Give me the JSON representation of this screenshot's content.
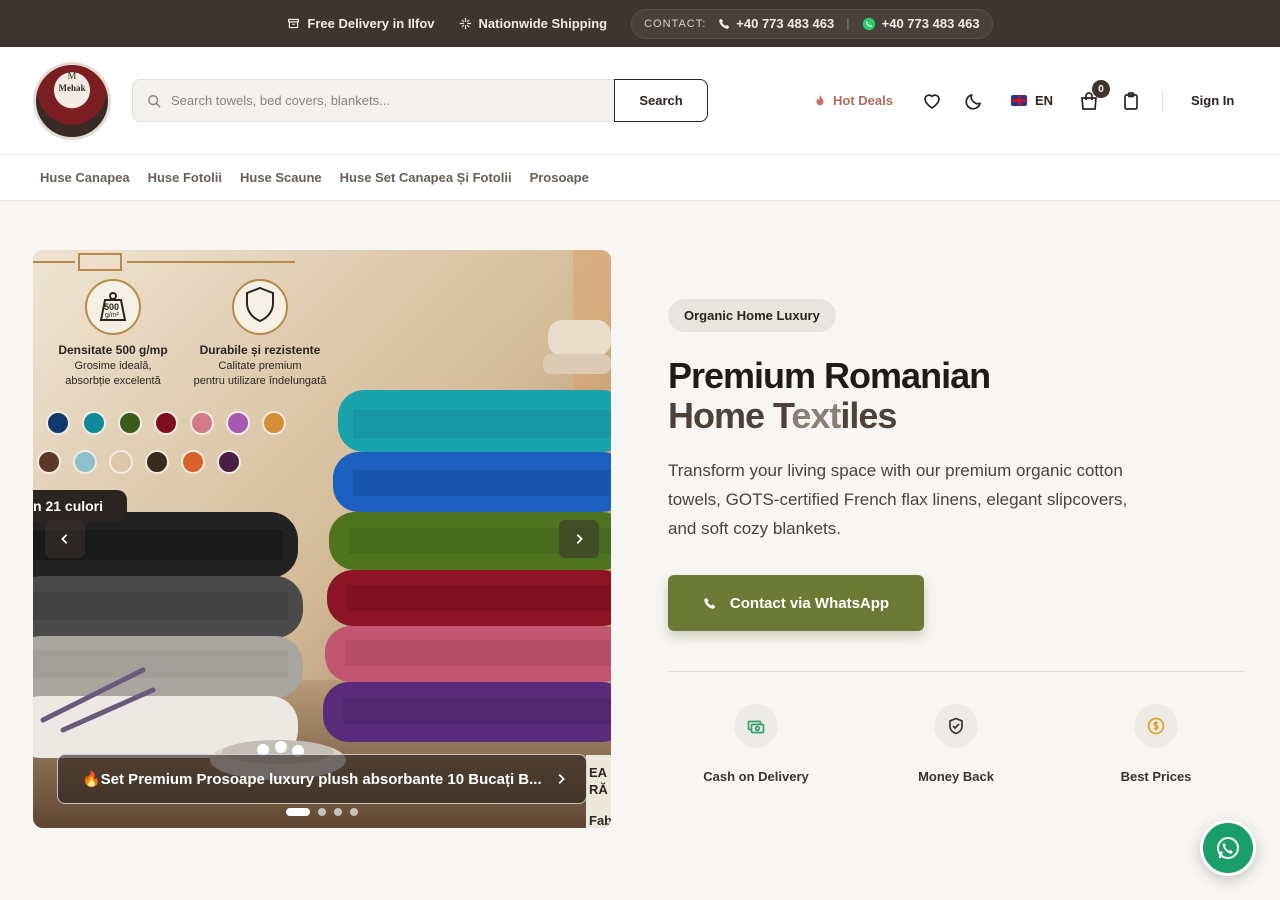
{
  "topbar": {
    "delivery": "Free Delivery in Ilfov",
    "shipping": "Nationwide Shipping",
    "contact_label": "CONTACT:",
    "phone": "+40 773 483 463",
    "whatsapp": "+40 773 483 463",
    "separator": "|"
  },
  "header": {
    "logo_text": "Mehak",
    "logo_initial": "M",
    "search_placeholder": "Search towels, bed covers, blankets...",
    "search_button": "Search",
    "hot_deals": "Hot Deals",
    "language": "EN",
    "cart_count": "0",
    "sign_in": "Sign In"
  },
  "nav": {
    "items": [
      {
        "label": "Huse Canapea"
      },
      {
        "label": "Huse Fotolii"
      },
      {
        "label": "Huse Scaune"
      },
      {
        "label": "Huse Set Canapea Și Fotolii"
      },
      {
        "label": "Prosoape"
      }
    ]
  },
  "slider": {
    "density_title": "Densitate 500 g/mp",
    "density_sub1": "Grosime ideală,",
    "density_sub2": "absorbție excelentă",
    "weight_label": "500",
    "weight_unit": "g/m²",
    "durable_title": "Durabile și rezistente",
    "durable_sub1": "Calitate premium",
    "durable_sub2": "pentru utilizare îndelungată",
    "colors_pill": "n 21 culori",
    "caption": "🔥Set Premium Prosoape luxury plush absorbante 10 Bucați B...",
    "edge_text1": "EA",
    "edge_text2": "RĂ",
    "edge_text3": "Fab",
    "swatches_row1": [
      "#0f3a6b",
      "#0c8a98",
      "#3b5a1c",
      "#7d0f1c",
      "#d27a8a",
      "#a65ab4",
      "#d59037"
    ],
    "swatches_row2": [
      "#5a3a26",
      "#8fbfc8",
      "#dbc7aa",
      "#3a2a1e",
      "#d8622a",
      "#4a1f45"
    ],
    "slide_count": 4,
    "active_slide": 1
  },
  "hero": {
    "badge": "Organic Home Luxury",
    "title_line1": "Premium Romanian",
    "title_line2a": "Home T",
    "title_line2b": "ext",
    "title_line2c": "iles",
    "lead": "Transform your living space with our premium organic cotton towels, GOTS-certified French flax linens, elegant slipcovers, and soft cozy blankets.",
    "cta": "Contact via WhatsApp"
  },
  "features": [
    {
      "label": "Cash on Delivery",
      "icon": "cash-icon",
      "color": "#2fa36b"
    },
    {
      "label": "Money Back",
      "icon": "shield-check-icon",
      "color": "#3a332e"
    },
    {
      "label": "Best Prices",
      "icon": "dollar-coin-icon",
      "color": "#e0a020"
    }
  ],
  "colors": {
    "topbar": "#3f3430",
    "accent_olive": "#6d7a35",
    "hot_deals": "#b16a5c",
    "whatsapp": "#1a9e6a"
  }
}
